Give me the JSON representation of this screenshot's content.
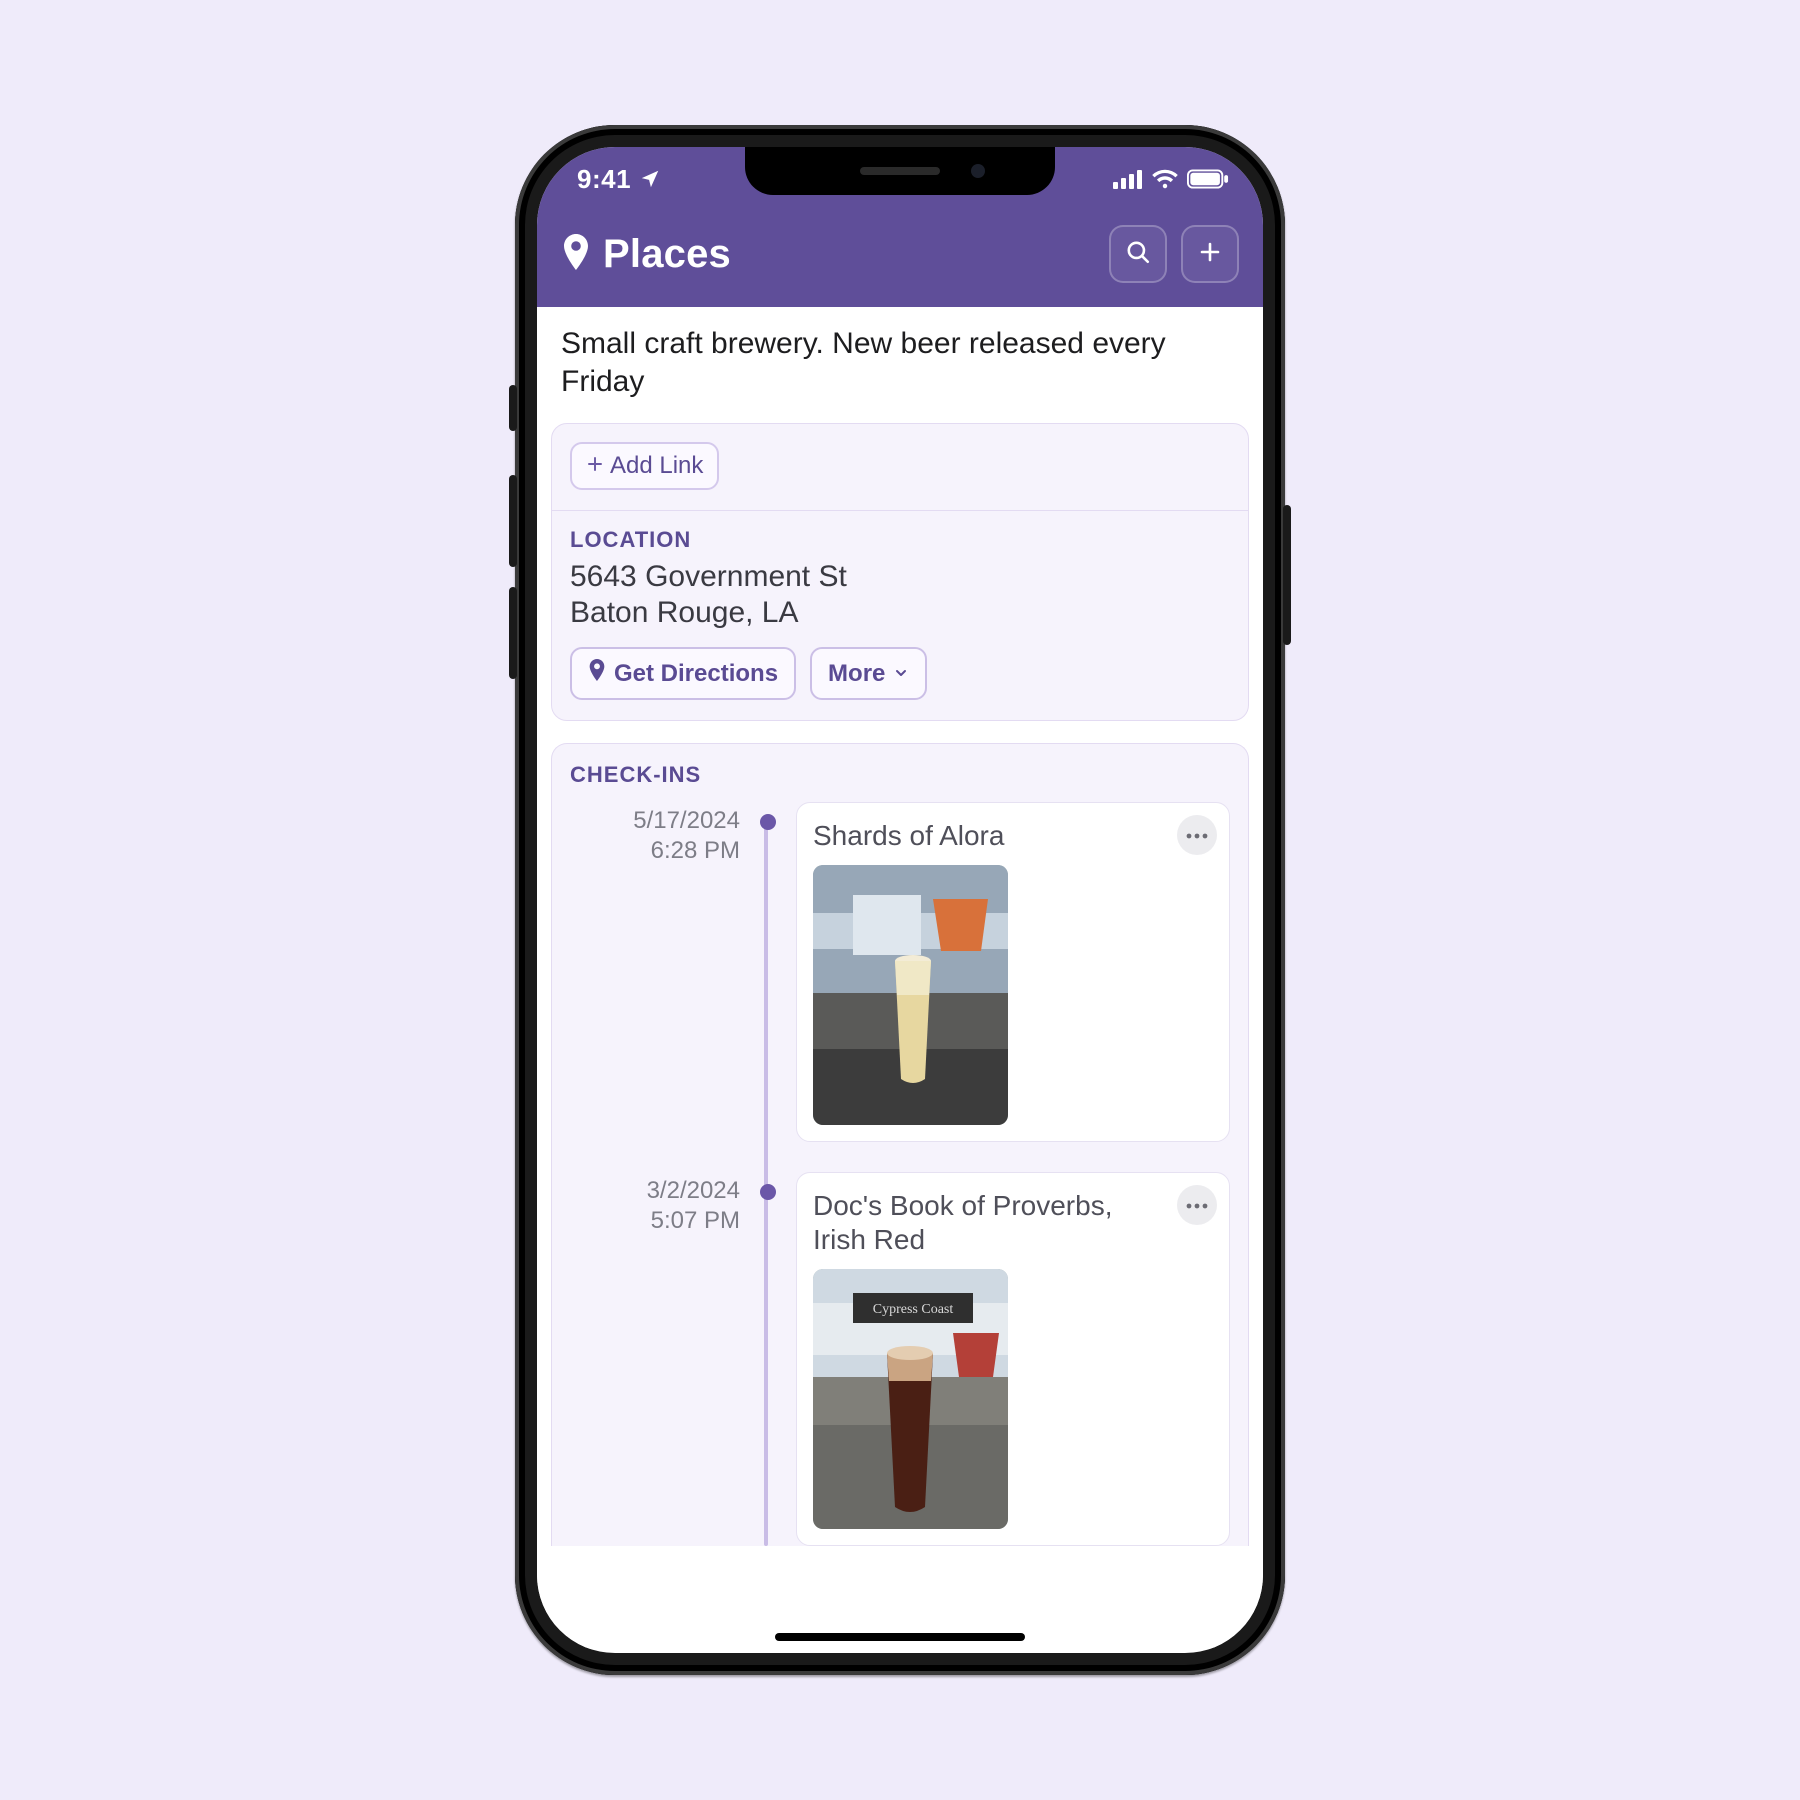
{
  "statusbar": {
    "time": "9:41"
  },
  "header": {
    "title": "Places"
  },
  "place": {
    "description": "Small craft brewery. New beer released every Friday",
    "add_link_label": "Add Link",
    "location_label": "LOCATION",
    "address_line1": "5643 Government St",
    "address_line2": "Baton Rouge, LA",
    "get_directions_label": "Get Directions",
    "more_label": "More"
  },
  "checkins": {
    "label": "CHECK-INS",
    "items": [
      {
        "date": "5/17/2024",
        "time": "6:28 PM",
        "title": "Shards of Alora"
      },
      {
        "date": "3/2/2024",
        "time": "5:07 PM",
        "title": "Doc's Book of Proverbs, Irish Red"
      }
    ]
  }
}
